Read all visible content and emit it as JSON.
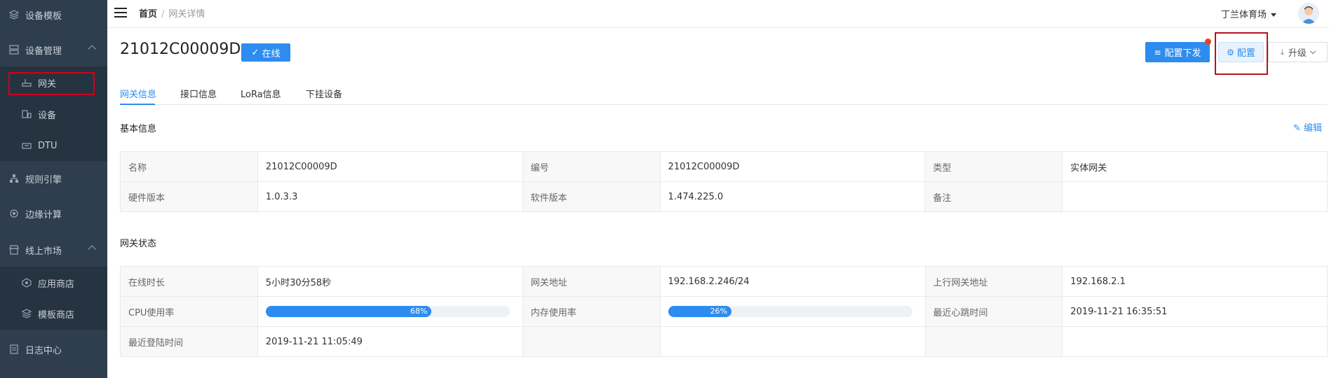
{
  "sidebar": {
    "items": [
      {
        "label": "设备模板",
        "icon": "layers-icon"
      },
      {
        "label": "设备管理",
        "icon": "server-icon"
      },
      {
        "label": "规则引擎",
        "icon": "sitemap-icon"
      },
      {
        "label": "边缘计算",
        "icon": "chip-icon"
      },
      {
        "label": "线上市场",
        "icon": "store-icon"
      },
      {
        "label": "日志中心",
        "icon": "document-icon"
      }
    ],
    "sub_items": [
      {
        "label": "网关",
        "icon": "router-icon"
      },
      {
        "label": "设备",
        "icon": "device-icon"
      },
      {
        "label": "DTU",
        "icon": "dtu-icon"
      },
      {
        "label": "应用商店",
        "icon": "app-store-icon"
      },
      {
        "label": "模板商店",
        "icon": "template-store-icon"
      }
    ]
  },
  "topbar": {
    "breadcrumb_home": "首页",
    "breadcrumb_sep": "/",
    "breadcrumb_current": "网关详情",
    "user_name": "丁兰体育场"
  },
  "header": {
    "title": "21012C00009D",
    "status": "在线",
    "btn_deploy": "配置下发",
    "btn_config": "配置",
    "btn_upgrade": "升级"
  },
  "tabs": [
    "网关信息",
    "接口信息",
    "LoRa信息",
    "下挂设备"
  ],
  "basic": {
    "title": "基本信息",
    "edit": "编辑",
    "rows": [
      [
        {
          "label": "名称",
          "value": "21012C00009D"
        },
        {
          "label": "编号",
          "value": "21012C00009D"
        },
        {
          "label": "类型",
          "value": "实体网关"
        }
      ],
      [
        {
          "label": "硬件版本",
          "value": "1.0.3.3"
        },
        {
          "label": "软件版本",
          "value": "1.474.225.0"
        },
        {
          "label": "备注",
          "value": ""
        }
      ]
    ]
  },
  "status": {
    "title": "网关状态",
    "uptime_label": "在线时长",
    "uptime": "5小时30分58秒",
    "addr_label": "网关地址",
    "addr": "192.168.2.246/24",
    "uplink_label": "上行网关地址",
    "uplink": "192.168.2.1",
    "cpu_label": "CPU使用率",
    "cpu": 68,
    "cpu_text": "68%",
    "mem_label": "内存使用率",
    "mem": 26,
    "mem_text": "26%",
    "heartbeat_label": "最近心跳时间",
    "heartbeat": "2019-11-21 16:35:51",
    "login_label": "最近登陆时间",
    "login": "2019-11-21 11:05:49"
  },
  "colors": {
    "accent": "#2d8cf0",
    "sidebar": "#2f3e4e",
    "highlight_box": "#d0021b"
  }
}
